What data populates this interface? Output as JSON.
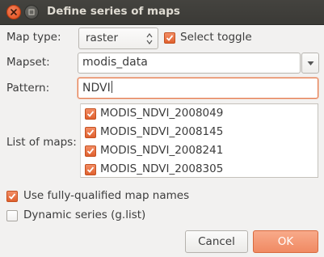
{
  "window": {
    "title": "Define series of maps"
  },
  "map_type": {
    "label": "Map type:",
    "value": "raster"
  },
  "select_toggle": {
    "label": "Select toggle",
    "checked": true
  },
  "mapset": {
    "label": "Mapset:",
    "value": "modis_data"
  },
  "pattern": {
    "label": "Pattern:",
    "value": "NDVI"
  },
  "maps": {
    "label": "List of maps:",
    "items": [
      {
        "name": "MODIS_NDVI_2008049",
        "checked": true
      },
      {
        "name": "MODIS_NDVI_2008145",
        "checked": true
      },
      {
        "name": "MODIS_NDVI_2008241",
        "checked": true
      },
      {
        "name": "MODIS_NDVI_2008305",
        "checked": true
      }
    ]
  },
  "fully_qualified": {
    "label": "Use fully-qualified map names",
    "checked": true
  },
  "dynamic_series": {
    "label": "Dynamic series (g.list)",
    "checked": false
  },
  "buttons": {
    "cancel_label": "Cancel",
    "ok_label": "OK"
  },
  "colors": {
    "accent": "#e8683a",
    "titlebar": "#3f3e3a",
    "window_bg": "#f2f1f0"
  },
  "icons": {
    "close": "close-icon",
    "maximize": "maximize-icon",
    "spin": "spin-arrows-icon",
    "dropdown": "chevron-down-icon",
    "check": "checkmark-icon"
  }
}
